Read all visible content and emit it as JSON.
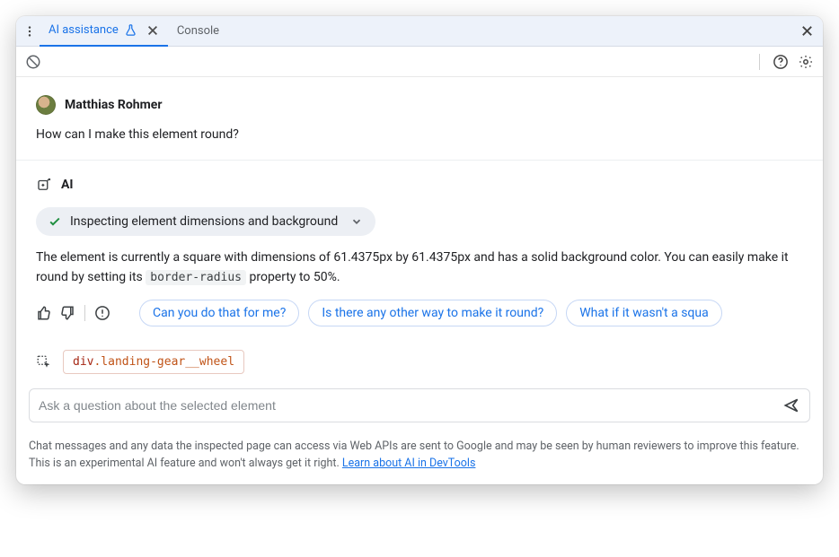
{
  "tabs": {
    "ai_assistance": "AI assistance",
    "console": "Console"
  },
  "user": {
    "name": "Matthias Rohmer",
    "message": "How can I make this element round?"
  },
  "ai": {
    "label": "AI",
    "status": "Inspecting element dimensions and background",
    "reply_part1": "The element is currently a square with dimensions of 61.4375px by 61.4375px and has a solid background color. You can easily make it round by setting its ",
    "reply_code": "border-radius",
    "reply_part2": " property to 50%."
  },
  "suggestions": {
    "s1": "Can you do that for me?",
    "s2": "Is there any other way to make it round?",
    "s3": "What if it wasn't a squa"
  },
  "selected": {
    "tag": "div",
    "cls": ".landing-gear__wheel"
  },
  "input": {
    "placeholder": "Ask a question about the selected element"
  },
  "disclaimer": {
    "text": "Chat messages and any data the inspected page can access via Web APIs are sent to Google and may be seen by human reviewers to improve this feature. This is an experimental AI feature and won't always get it right. ",
    "link": "Learn about AI in DevTools"
  }
}
